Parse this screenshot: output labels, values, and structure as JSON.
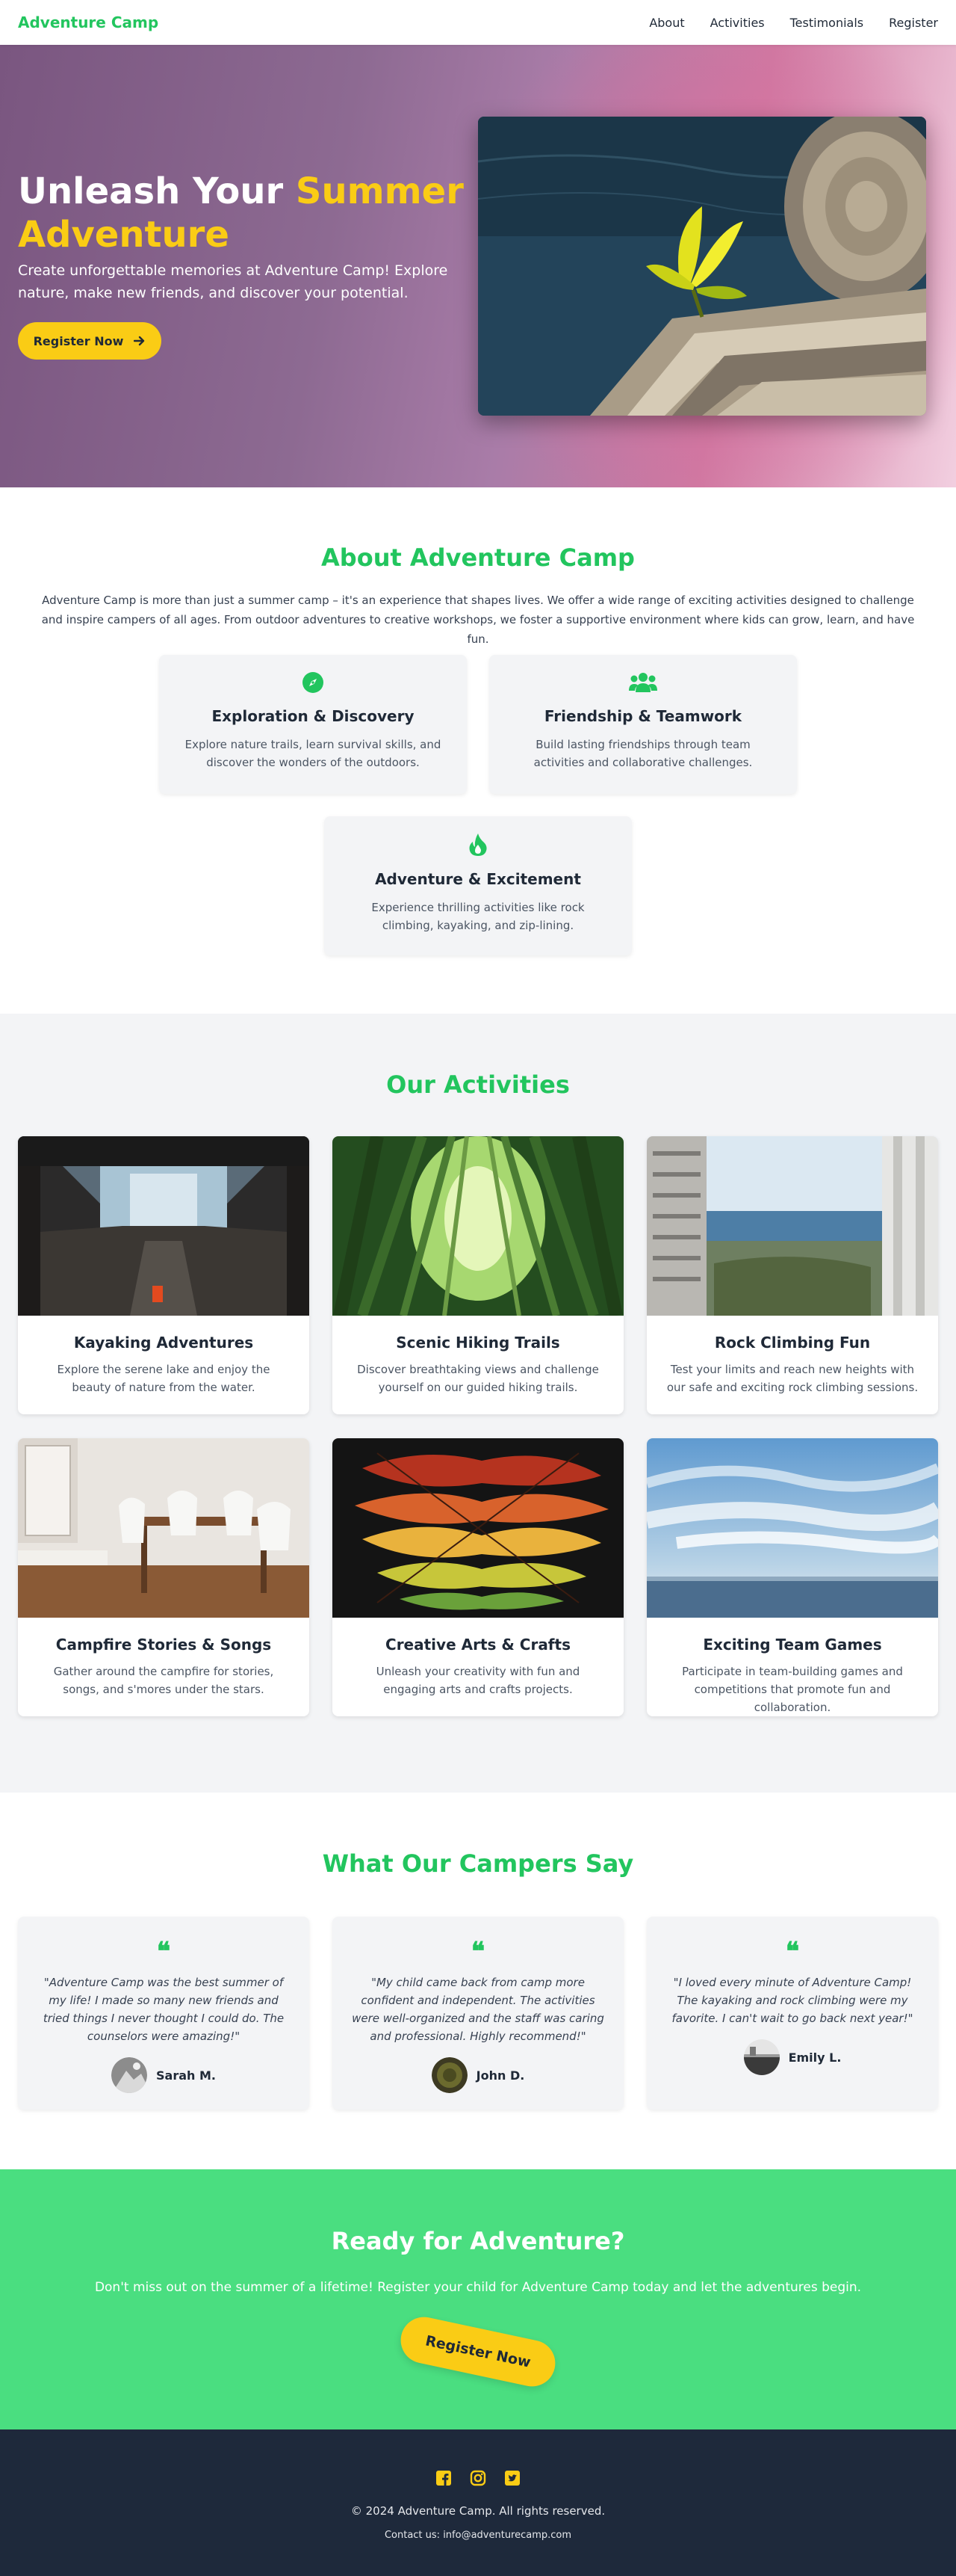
{
  "nav": {
    "brand": "Adventure Camp",
    "links": [
      "About",
      "Activities",
      "Testimonials",
      "Register"
    ]
  },
  "hero": {
    "title_part1": "Unleash Your ",
    "title_accent": "Summer Adventure",
    "subtitle": "Create unforgettable memories at Adventure Camp! Explore nature, make new friends, and discover your potential.",
    "button": "Register Now",
    "button_icon": "arrow-right-icon",
    "image": "leaf-on-tree-stump-photo"
  },
  "about": {
    "title": "About Adventure Camp",
    "text": "Adventure Camp is more than just a summer camp – it's an experience that shapes lives. We offer a wide range of exciting activities designed to challenge and inspire campers of all ages. From outdoor adventures to creative workshops, we foster a supportive environment where kids can grow, learn, and have fun.",
    "features": [
      {
        "icon": "compass-icon",
        "title": "Exploration & Discovery",
        "desc": "Explore nature trails, learn survival skills, and discover the wonders of the outdoors."
      },
      {
        "icon": "users-icon",
        "title": "Friendship & Teamwork",
        "desc": "Build lasting friendships through team activities and collaborative challenges."
      },
      {
        "icon": "fire-icon",
        "title": "Adventure & Excitement",
        "desc": "Experience thrilling activities like rock climbing, kayaking, and zip-lining."
      }
    ]
  },
  "activities": {
    "title": "Our Activities",
    "items": [
      {
        "title": "Kayaking Adventures",
        "desc": "Explore the serene lake and enjoy the beauty of nature from the water.",
        "image": "corridor-photo"
      },
      {
        "title": "Scenic Hiking Trails",
        "desc": "Discover breathtaking views and challenge yourself on our guided hiking trails.",
        "image": "bamboo-forest-photo"
      },
      {
        "title": "Rock Climbing Fun",
        "desc": "Test your limits and reach new heights with our safe and exciting rock climbing sessions.",
        "image": "seaside-buildings-photo"
      },
      {
        "title": "Campfire Stories & Songs",
        "desc": "Gather around the campfire for stories, songs, and s'mores under the stars.",
        "image": "dining-room-photo"
      },
      {
        "title": "Creative Arts & Crafts",
        "desc": "Unleash your creativity with fun and engaging arts and crafts projects.",
        "image": "autumn-leaves-photo"
      },
      {
        "title": "Exciting Team Games",
        "desc": "Participate in team-building games and competitions that promote fun and collaboration.",
        "image": "sky-and-sea-photo"
      }
    ]
  },
  "testimonials": {
    "title": "What Our Campers Say",
    "quote_icon": "quote-left-icon",
    "items": [
      {
        "text": "\"Adventure Camp was the best summer of my life! I made so many new friends and tried things I never thought I could do. The counselors were amazing!\"",
        "name": "Sarah M."
      },
      {
        "text": "\"My child came back from camp more confident and independent. The activities were well-organized and the staff was caring and professional. Highly recommend!\"",
        "name": "John D."
      },
      {
        "text": "\"I loved every minute of Adventure Camp! The kayaking and rock climbing were my favorite. I can't wait to go back next year!\"",
        "name": "Emily L."
      }
    ]
  },
  "cta": {
    "title": "Ready for Adventure?",
    "text": "Don't miss out on the summer of a lifetime! Register your child for Adventure Camp today and let the adventures begin.",
    "button": "Register Now"
  },
  "footer": {
    "social": [
      "facebook-icon",
      "instagram-icon",
      "twitter-icon"
    ],
    "copyright": "© 2024 Adventure Camp. All rights reserved.",
    "contact": "Contact us: info@adventurecamp.com"
  },
  "colors": {
    "primary": "#22c55e",
    "accent": "#facc15",
    "cta_bg": "#4ade80",
    "footer_bg": "#1e293b"
  }
}
